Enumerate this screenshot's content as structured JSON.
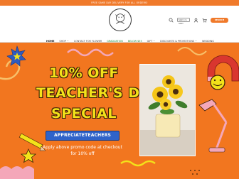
{
  "topbar": {
    "text": "FREE SAME DAY DELIVERY FOR ALL ORDERS!"
  },
  "header": {
    "currency": "SGD | $ SGD",
    "search_label": "SEARCH"
  },
  "nav": {
    "items": [
      {
        "label": "HOME"
      },
      {
        "label": "SHOP ~"
      },
      {
        "label": "CONTACT FOR FLOWER"
      },
      {
        "label": "GRADUATION"
      },
      {
        "label": "BELOW $55"
      },
      {
        "label": "GIFT ~"
      },
      {
        "label": "DISCOUNTS & PROMOTIONS ~"
      },
      {
        "label": "WEDDING"
      }
    ]
  },
  "hero": {
    "line1": "10% OFF",
    "line2": "TEACHER'S DAY",
    "line3": "SPECIAL",
    "promo_code": "APPRECIATETEACHERS",
    "promo_text": "Apply above promo code at checkout for 10% off"
  },
  "colors": {
    "brand_orange": "#f07a2b",
    "hero_bg": "#f2761f",
    "headline_yellow": "#f3e21a",
    "button_blue": "#2f63c9"
  },
  "icons": [
    "search-icon",
    "user-icon",
    "cart-icon",
    "logo-icon"
  ]
}
